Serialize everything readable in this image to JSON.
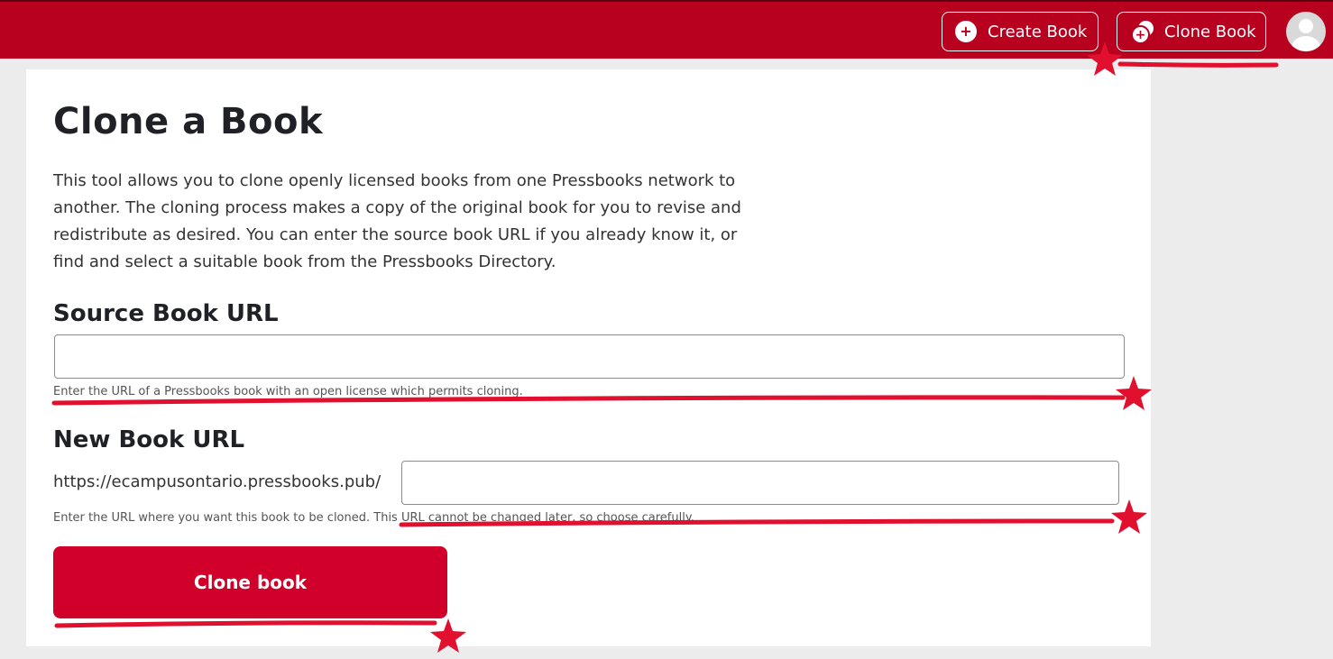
{
  "header": {
    "create_book_label": "Create Book",
    "clone_book_label": "Clone Book",
    "plus_symbol": "+",
    "bg_color": "#b8001f"
  },
  "main": {
    "title": "Clone a Book",
    "intro": "This tool allows you to clone openly licensed books from one Pressbooks network to another. The cloning process makes a copy of the original book for you to revise and redistribute as desired. You can enter the source book URL if you already know it, or find and select a suitable book from the Pressbooks Directory.",
    "source": {
      "label": "Source Book URL",
      "value": "",
      "help": "Enter the URL of a Pressbooks book with an open license which permits cloning."
    },
    "new_book": {
      "label": "New Book URL",
      "prefix": "https://ecampusontario.pressbooks.pub/",
      "value": "",
      "help": "Enter the URL where you want this book to be cloned. This URL cannot be changed later, so choose carefully."
    },
    "submit_label": "Clone book",
    "button_color": "#d1002a"
  },
  "annotations": {
    "mark_color": "#e0102e",
    "marks": [
      "star",
      "underline"
    ]
  }
}
